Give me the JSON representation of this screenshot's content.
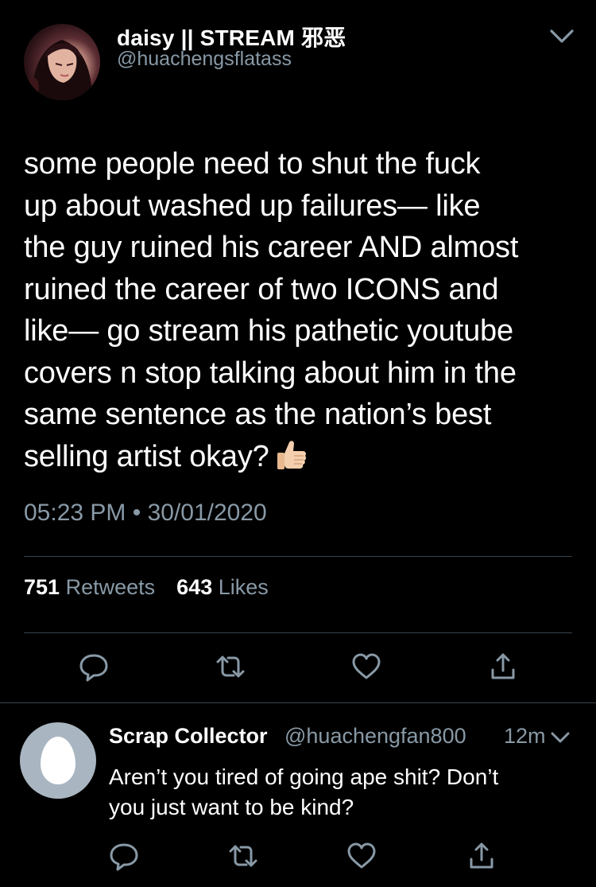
{
  "tweet": {
    "display_name": "daisy || STREAM 邪恶",
    "handle": "@huachengsflatass",
    "text_lines": [
      "some people need to shut the fuck",
      "up about washed up failures— like",
      "the guy ruined his career AND almost",
      "ruined the career of two ICONS and",
      "like— go stream his pathetic youtube",
      "covers n stop talking about him in the",
      "same sentence as the nation’s best",
      "selling artist okay?"
    ],
    "emoji": "thumbs-up-icon",
    "timestamp": "05:23 PM • 30/01/2020",
    "stats": {
      "retweets_count": "751",
      "retweets_label": "Retweets",
      "likes_count": "643",
      "likes_label": "Likes"
    }
  },
  "reply": {
    "display_name": "Scrap Collector",
    "handle": "@huachengfan800",
    "time": "12m",
    "text_lines": [
      "Aren’t you tired of going ape shit? Don’t",
      "you just want to be kind?"
    ]
  },
  "icons": {
    "more": "chevron-down-icon",
    "reply": "reply-icon",
    "retweet": "retweet-icon",
    "like": "heart-icon",
    "share": "share-icon"
  },
  "colors": {
    "background": "#000000",
    "text": "#ffffff",
    "secondary_text": "#8899a6",
    "divider": "#38444d",
    "default_avatar": "#a9b6c1"
  }
}
